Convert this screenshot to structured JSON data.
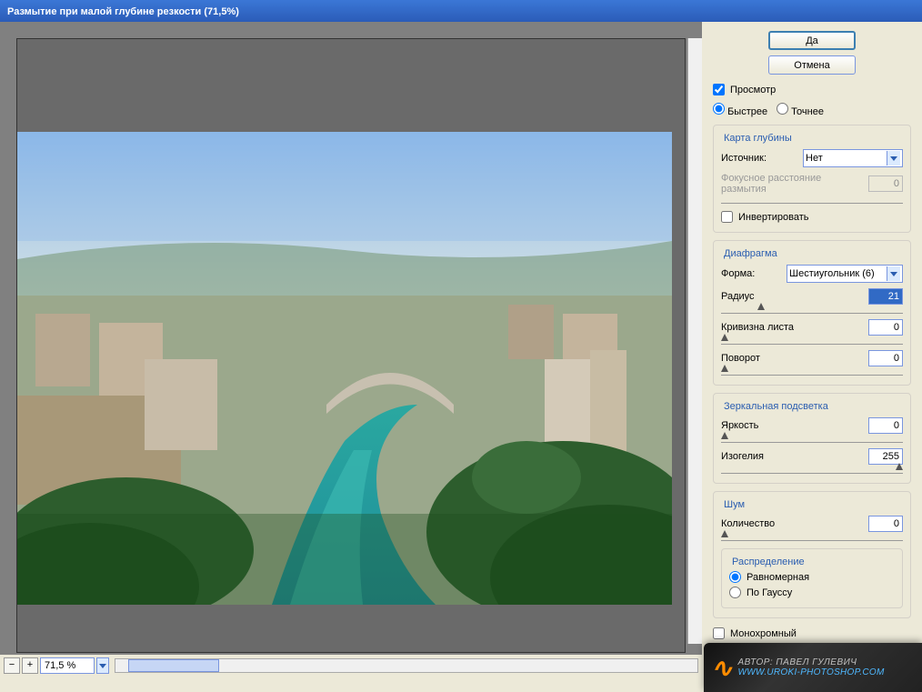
{
  "title": "Размытие при малой глубине резкости (71,5%)",
  "buttons": {
    "ok": "Да",
    "cancel": "Отмена"
  },
  "preview": {
    "label": "Просмотр",
    "checked": true
  },
  "speed": {
    "fast": "Быстрее",
    "accurate": "Точнее",
    "selected": "fast"
  },
  "depth_map": {
    "title": "Карта глубины",
    "source_label": "Источник:",
    "source_value": "Нет",
    "focal_label": "Фокусное расстояние размытия",
    "focal_value": "0",
    "invert_label": "Инвертировать",
    "invert_checked": false
  },
  "iris": {
    "title": "Диафрагма",
    "shape_label": "Форма:",
    "shape_value": "Шестиугольник (6)",
    "radius_label": "Радиус",
    "radius_value": "21",
    "blade_label": "Кривизна листа",
    "blade_value": "0",
    "rotation_label": "Поворот",
    "rotation_value": "0"
  },
  "specular": {
    "title": "Зеркальная подсветка",
    "brightness_label": "Яркость",
    "brightness_value": "0",
    "threshold_label": "Изогелия",
    "threshold_value": "255"
  },
  "noise": {
    "title": "Шум",
    "amount_label": "Количество",
    "amount_value": "0",
    "dist_title": "Распределение",
    "uniform": "Равномерная",
    "gaussian": "По Гауссу",
    "selected": "uniform"
  },
  "mono": {
    "label": "Монохромный",
    "checked": false
  },
  "zoom": {
    "value": "71,5 %"
  },
  "watermark": {
    "logo": "∿",
    "author": "АВТОР: ПАВЕЛ ГУЛЕВИЧ",
    "site": "WWW.UROKI-PHOTOSHOP.COM"
  }
}
